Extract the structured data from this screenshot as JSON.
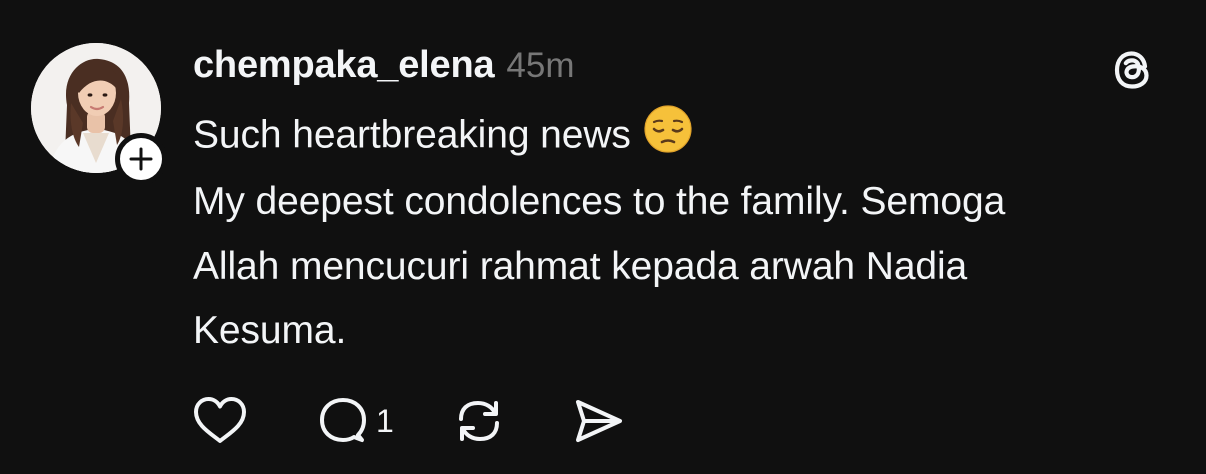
{
  "post": {
    "username": "chempaka_elena",
    "timestamp": "45m",
    "lines": [
      "Such heartbreaking news",
      "My deepest condolences to the family. Semoga",
      "Allah mencucuri rahmat kepada arwah Nadia",
      "Kesuma."
    ],
    "emoji": "pensive-face",
    "reply_count": "1"
  },
  "icons": {
    "app_logo": "threads-logo-icon",
    "follow": "plus-icon",
    "like": "heart-icon",
    "reply": "speech-bubble-icon",
    "repost": "repost-icon",
    "share": "send-icon"
  },
  "colors": {
    "background": "#101010",
    "text_primary": "#f3f5f7",
    "text_secondary": "#777777",
    "emoji": "#f6c13a"
  }
}
